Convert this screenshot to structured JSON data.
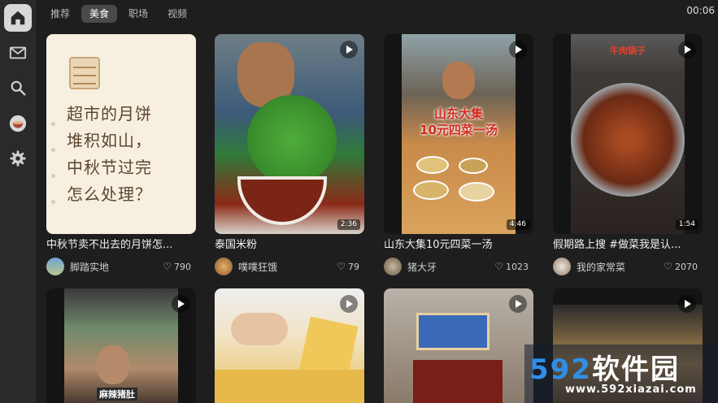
{
  "sidebar": {
    "items": [
      {
        "icon": "home-icon",
        "active": true
      },
      {
        "icon": "mail-icon"
      },
      {
        "icon": "search-icon"
      },
      {
        "icon": "bowl-icon"
      },
      {
        "icon": "gear-icon"
      }
    ]
  },
  "tabs": [
    {
      "label": "推荐"
    },
    {
      "label": "美食",
      "active": true
    },
    {
      "label": "职场"
    },
    {
      "label": "视频"
    }
  ],
  "clock": "00:06",
  "cards": [
    {
      "note_lines": [
        "超市的月饼",
        "堆积如山，",
        "中秋节过完",
        "怎么处理？"
      ],
      "title": "中秋节卖不出去的月饼怎...",
      "author": "脚踏实地",
      "likes": "790"
    },
    {
      "duration": "2:36",
      "title": "泰国米粉",
      "author": "噗噗狂饿",
      "likes": "79"
    },
    {
      "duration": "4:46",
      "overlay": [
        "山东大集",
        "10元四菜一汤"
      ],
      "title": "山东大集10元四菜一汤",
      "author": "猪大牙",
      "likes": "1023"
    },
    {
      "duration": "1:54",
      "overlay": [
        "牛肉锅子"
      ],
      "title": "假期路上搜 #做菜我是认...",
      "author": "我的家常菜",
      "likes": "2070"
    },
    {
      "overlay": [
        "麻辣猪肚"
      ]
    },
    {},
    {},
    {}
  ],
  "watermark": {
    "main_digits": "592",
    "main_text": "软件园",
    "url": "www.592xiazai.com"
  },
  "colors": {
    "background": "#1e1e1e",
    "sidebar": "#2a2a2a",
    "active_tab": "#4a4a4a",
    "watermark_blue": "#2f8fe6"
  }
}
